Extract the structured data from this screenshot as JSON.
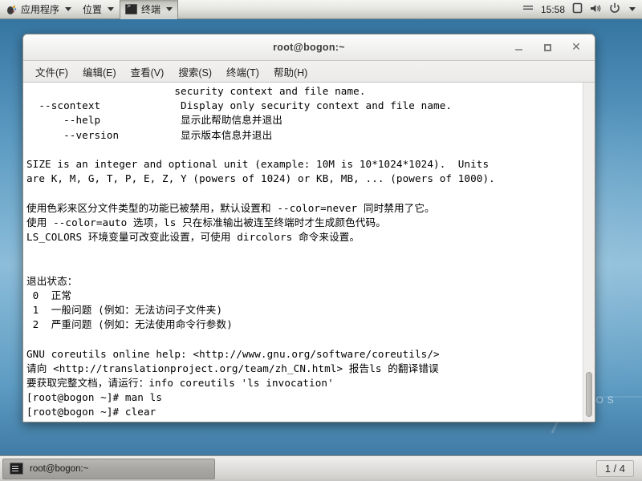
{
  "top_panel": {
    "applications_label": "应用程序",
    "places_label": "位置",
    "terminal_label": "终端",
    "clock": "15:58",
    "icons": {
      "gnome_foot": "gnome-foot-icon",
      "display": "display-icon",
      "volume": "volume-icon",
      "power": "power-icon",
      "chevron": "chevron-down-icon"
    }
  },
  "window": {
    "title": "root@bogon:~",
    "buttons": {
      "minimize": "minimize-button",
      "maximize": "maximize-button",
      "close": "close-button"
    },
    "menu": [
      {
        "label": "文件(F)"
      },
      {
        "label": "编辑(E)"
      },
      {
        "label": "查看(V)"
      },
      {
        "label": "搜索(S)"
      },
      {
        "label": "终端(T)"
      },
      {
        "label": "帮助(H)"
      }
    ]
  },
  "terminal": {
    "content": "                        security context and file name.\n  --scontext             Display only security context and file name.\n      --help             显示此帮助信息并退出\n      --version          显示版本信息并退出\n\nSIZE is an integer and optional unit (example: 10M is 10*1024*1024).  Units\nare K, M, G, T, P, E, Z, Y (powers of 1024) or KB, MB, ... (powers of 1000).\n\n使用色彩来区分文件类型的功能已被禁用，默认设置和 --color=never 同时禁用了它。\n使用 --color=auto 选项，ls 只在标准输出被连至终端时才生成颜色代码。\nLS_COLORS 环境变量可改变此设置，可使用 dircolors 命令来设置。\n\n\n退出状态：\n 0  正常\n 1  一般问题 (例如：无法访问子文件夹)\n 2  严重问题 (例如：无法使用命令行参数)\n\nGNU coreutils online help: <http://www.gnu.org/software/coreutils/>\n请向 <http://translationproject.org/team/zh_CN.html> 报告ls 的翻译错误\n要获取完整文档，请运行：info coreutils 'ls invocation'\n[root@bogon ~]# man ls\n[root@bogon ~]# clear"
  },
  "bottom_panel": {
    "task_label": "root@bogon:~",
    "workspace_label": "1 / 4"
  },
  "wallpaper": {
    "brand_text": "CENTOS",
    "logo": "centos-7-logo"
  },
  "colors": {
    "desktop_blue": "#5e9cc3",
    "panel_gray": "#e2e1df",
    "terminal_bg": "#ffffff",
    "terminal_fg": "#000000"
  }
}
